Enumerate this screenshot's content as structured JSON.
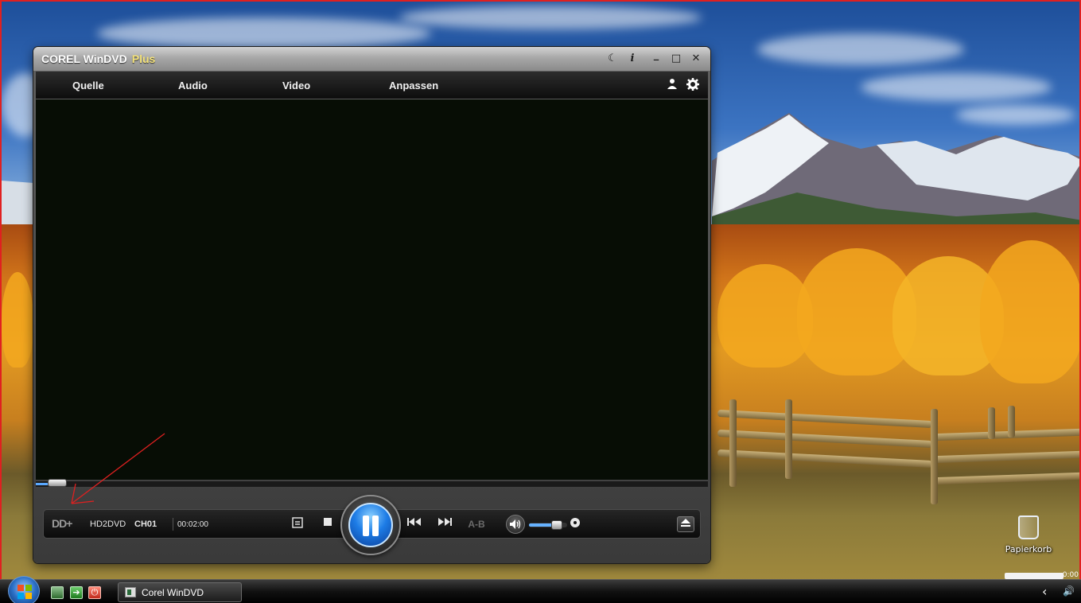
{
  "app": {
    "title": "COREL WinDVD",
    "edition": "Plus"
  },
  "titlebar_buttons": [
    {
      "name": "moon-icon",
      "glyph": "☾"
    },
    {
      "name": "info-icon",
      "glyph": "i"
    },
    {
      "name": "minimize-icon",
      "glyph": "_"
    },
    {
      "name": "maximize-icon",
      "glyph": "□"
    },
    {
      "name": "close-icon",
      "glyph": "✕"
    }
  ],
  "menu": {
    "items": [
      "Quelle",
      "Audio",
      "Video",
      "Anpassen"
    ]
  },
  "controls": {
    "dolby_logo": "DD+",
    "disc_type": "HD2DVD",
    "chapter": "CH01",
    "time": "00:02:00",
    "ab_label": "A-B",
    "seek_progress": 0.02,
    "volume_level": 0.72
  },
  "desktop": {
    "recycle_bin_label": "Papierkorb",
    "sidebar_clock": "0:00"
  },
  "taskbar": {
    "active_window_label": "Corel WinDVD",
    "tray_arrow": "‹",
    "volume_glyph": "🔊"
  },
  "colors": {
    "accent_blue": "#1d7ce6",
    "video_bg": "#070d05",
    "annotation_red": "#e02020"
  }
}
